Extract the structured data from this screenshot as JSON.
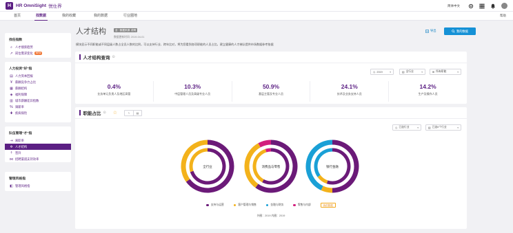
{
  "header": {
    "logo_letter": "H",
    "brand": "HR OmniSight",
    "brand_cn": "悦仕界",
    "language": "简体中文",
    "icons": [
      "settings-icon",
      "apps-icon",
      "bell-icon",
      "avatar"
    ]
  },
  "nav": {
    "tabs": [
      {
        "label": "首页",
        "active": false
      },
      {
        "label": "找数据",
        "active": true
      },
      {
        "label": "我的收藏",
        "active": false
      },
      {
        "label": "我的数据",
        "active": false
      },
      {
        "label": "行业圈地",
        "active": false
      }
    ],
    "help": "帮助"
  },
  "sidebar": {
    "groups": [
      {
        "title": "找任指数",
        "items": [
          {
            "label": "人才搜索趋势",
            "icon": "search-icon"
          },
          {
            "label": "岗位需求变化",
            "icon": "trend-icon",
            "badge": "NEW"
          }
        ]
      },
      {
        "title": "人力投资\"好\"指",
        "items": [
          {
            "label": "人力资本回报",
            "icon": "chart-icon"
          },
          {
            "label": "薪酬竞争力占比",
            "icon": "money-icon"
          },
          {
            "label": "薪酬结构",
            "icon": "structure-icon"
          },
          {
            "label": "福利保障",
            "icon": "shield-icon"
          },
          {
            "label": "城市薪酬差异指数",
            "icon": "city-icon"
          },
          {
            "label": "调薪率",
            "icon": "percent-icon"
          },
          {
            "label": "疾病保险",
            "icon": "health-icon"
          }
        ]
      },
      {
        "title": "队伍管理\"才\"指",
        "items": [
          {
            "label": "离职率",
            "icon": "exit-icon"
          },
          {
            "label": "人才结构",
            "icon": "structure-icon",
            "active": true
          },
          {
            "label": "晋升",
            "icon": "promote-icon"
          },
          {
            "label": "招聘渠道支持效率",
            "icon": "recruit-icon"
          }
        ]
      },
      {
        "title": "管理风格指",
        "items": [
          {
            "label": "管理风格指",
            "icon": "style-icon"
          }
        ]
      }
    ]
  },
  "page": {
    "title": "人才结构",
    "tag1": "全 · 数据来源",
    "tag2": "说明",
    "update": "数据更新时间: 2019-04-01",
    "description": "模块显示不同职能或不同层级人数占全员人数的比例，可以支持行业、跨年比对，将为您看到各项职能的人员占比，建立健康的人才梯队提供市场数据参考依据",
    "export_label": "导出",
    "report_label": "我的数据"
  },
  "query_card": {
    "title": "人才结构查询",
    "filters": {
      "year": "2019",
      "industry": "全行业",
      "function": "所有职能"
    },
    "stats": [
      {
        "value": "0.4%",
        "label": "业务单元负责人及地区高管"
      },
      {
        "value": "10.3%",
        "label": "中层管理人员及高级专业人员"
      },
      {
        "value": "50.9%",
        "label": "基层主管及专业人员"
      },
      {
        "value": "24.1%",
        "label": "技术及业务支持人员"
      },
      {
        "value": "14.2%",
        "label": "生产及操作人员"
      }
    ]
  },
  "ratio_card": {
    "title": "职能占比",
    "filters": {
      "type": "已选行业",
      "scope": "已选5个行业"
    },
    "view_icons": [
      "line-chart-icon",
      "table-icon"
    ],
    "legend": [
      {
        "label": "支持与运营",
        "color": "#6b1a78"
      },
      {
        "label": "客户管理与销售",
        "color": "#f3b21b"
      },
      {
        "label": "金融与财务",
        "color": "#1aa0d6"
      },
      {
        "label": "零售与内部",
        "color": "#d21e7d"
      }
    ],
    "legend_button": "我的数据",
    "footnote": "外圈：2019    内圈：2019"
  },
  "chart_data": {
    "type": "pie",
    "series": [
      {
        "name": "全行业",
        "outer": [
          65,
          35,
          0,
          0
        ],
        "inner": [
          70,
          30,
          0,
          0
        ]
      },
      {
        "name": "消费品与零售",
        "outer": [
          60,
          32,
          0,
          8
        ],
        "inner": [
          58,
          37,
          0,
          5
        ]
      },
      {
        "name": "银行金融",
        "outer": [
          50,
          7,
          43,
          0
        ],
        "inner": [
          55,
          10,
          35,
          0
        ]
      }
    ],
    "categories": [
      "支持与运营",
      "客户管理与销售",
      "金融与财务",
      "零售与内部"
    ]
  }
}
